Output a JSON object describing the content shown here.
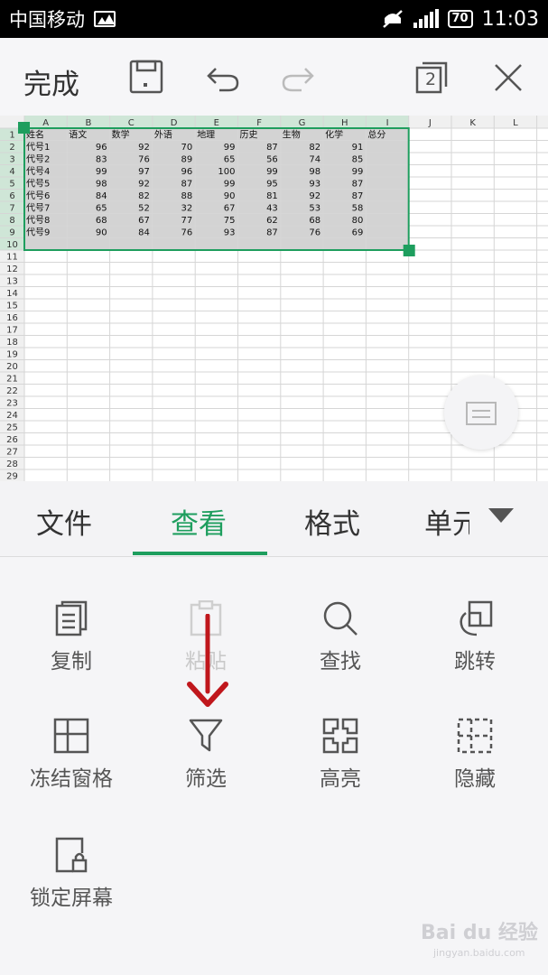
{
  "status_bar": {
    "carrier": "中国移动",
    "battery": "70",
    "time": "11:03"
  },
  "toolbar": {
    "done_label": "完成",
    "window_count": "2"
  },
  "spreadsheet": {
    "columns": [
      "A",
      "B",
      "C",
      "D",
      "E",
      "F",
      "G",
      "H",
      "I",
      "J",
      "K",
      "L"
    ],
    "row_count": 29,
    "headers": [
      "姓名",
      "语文",
      "数学",
      "外语",
      "地理",
      "历史",
      "生物",
      "化学",
      "总分"
    ],
    "rows": [
      [
        "代号1",
        "96",
        "92",
        "70",
        "99",
        "87",
        "82",
        "91"
      ],
      [
        "代号2",
        "83",
        "76",
        "89",
        "65",
        "56",
        "74",
        "85"
      ],
      [
        "代号4",
        "99",
        "97",
        "96",
        "100",
        "99",
        "98",
        "99"
      ],
      [
        "代号5",
        "98",
        "92",
        "87",
        "99",
        "95",
        "93",
        "87"
      ],
      [
        "代号6",
        "84",
        "82",
        "88",
        "90",
        "81",
        "92",
        "87"
      ],
      [
        "代号7",
        "65",
        "52",
        "32",
        "67",
        "43",
        "53",
        "58"
      ],
      [
        "代号8",
        "68",
        "67",
        "77",
        "75",
        "62",
        "68",
        "80"
      ],
      [
        "代号9",
        "90",
        "84",
        "76",
        "93",
        "87",
        "76",
        "69"
      ]
    ],
    "selection": "A1:I10"
  },
  "tabs": [
    {
      "label": "文件",
      "active": false
    },
    {
      "label": "查看",
      "active": true
    },
    {
      "label": "格式",
      "active": false
    },
    {
      "label": "单元",
      "active": false
    }
  ],
  "actions": [
    {
      "label": "复制",
      "icon": "copy-icon",
      "enabled": true
    },
    {
      "label": "粘贴",
      "icon": "paste-icon",
      "enabled": false
    },
    {
      "label": "查找",
      "icon": "search-icon",
      "enabled": true
    },
    {
      "label": "跳转",
      "icon": "jump-icon",
      "enabled": true
    },
    {
      "label": "冻结窗格",
      "icon": "freeze-panes-icon",
      "enabled": true
    },
    {
      "label": "筛选",
      "icon": "filter-icon",
      "enabled": true
    },
    {
      "label": "高亮",
      "icon": "highlight-icon",
      "enabled": true
    },
    {
      "label": "隐藏",
      "icon": "hide-icon",
      "enabled": true
    },
    {
      "label": "锁定屏幕",
      "icon": "lock-screen-icon",
      "enabled": true
    }
  ],
  "colors": {
    "accent": "#1e9e5e",
    "selection_fill": "#d3d3d3",
    "annotation_arrow": "#c0171c"
  },
  "watermark": {
    "brand": "Bai du 经验",
    "url": "jingyan.baidu.com"
  }
}
